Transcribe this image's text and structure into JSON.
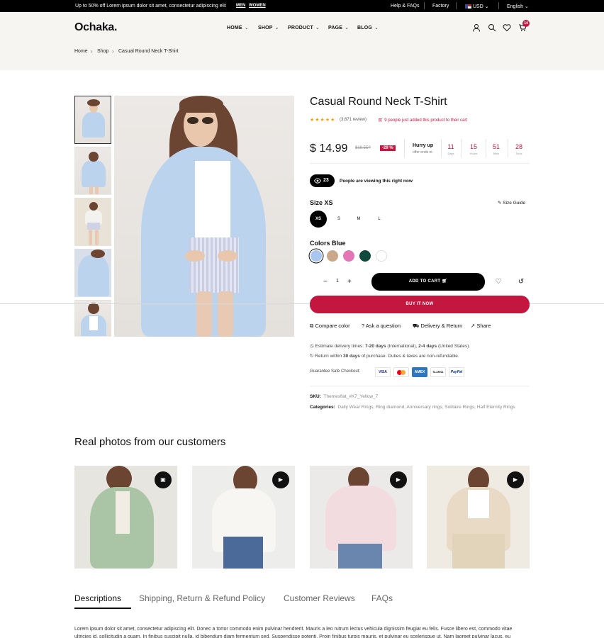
{
  "topbar": {
    "promo": "Up to 50% off Lorem ipsum dolor sit amet, consectetur adipiscing elit",
    "link_men": "MEN",
    "link_women": "WOMEN",
    "help": "Help & FAQs",
    "factory": "Factory",
    "currency": "USD",
    "language": "English"
  },
  "header": {
    "logo": "Ochaka.",
    "nav": [
      "HOME",
      "SHOP",
      "PRODUCT",
      "PAGE",
      "BLOG"
    ],
    "cart_count": "14"
  },
  "breadcrumb": [
    "Home",
    "Shop",
    "Casual Round Neck T-Shirt"
  ],
  "product": {
    "title": "Casual Round Neck T-Shirt",
    "stars": "★★★★★",
    "reviews": "(3,671 review)",
    "cart_note": "9 people just added this product to their cart",
    "price": "$ 14.99",
    "old_price": "$19.55?",
    "discount": "-29 %",
    "hurry": "Hurry up",
    "offer_ends": "offer ends in:",
    "countdown": [
      {
        "value": "11",
        "label": "Days"
      },
      {
        "value": "15",
        "label": "Hours"
      },
      {
        "value": "51",
        "label": "Mins"
      },
      {
        "value": "28",
        "label": "Secs"
      }
    ],
    "viewers_count": "23",
    "viewers_text": "People are viewing this right now",
    "size_label": "Size XS",
    "size_guide": "Size Guide",
    "sizes": [
      "XS",
      "S",
      "M",
      "L"
    ],
    "colors_label": "Colors Blue",
    "colors": [
      "#a9c6ee",
      "#c9a98a",
      "#e377b6",
      "#0f4a3c",
      "#ffffff"
    ],
    "quantity": "1",
    "add_to_cart": "ADD TO CART",
    "buy_now": "BUY IT NOW",
    "actions": [
      "Compare color",
      "Ask a question",
      "Delivery & Return",
      "Share"
    ],
    "delivery_prefix": "Estimate delivery times:",
    "delivery_intl": "7-20 days",
    "delivery_intl_suffix": "(International),",
    "delivery_us": "2-4 days",
    "delivery_us_suffix": "(United States).",
    "return_prefix": "Return within",
    "return_days": "30 days",
    "return_suffix": "of purchase. Duties & taxes are non-refundable.",
    "checkout_label": "Guarantee Safe Checkout:",
    "payments": [
      "VISA",
      "MC",
      "AMEX",
      "KLARNA",
      "PayPal"
    ],
    "sku_label": "SKU:",
    "sku": "Themesflat_#K7_Yellow_7",
    "categories_label": "Categories:",
    "categories": "Daily Wear Rings, Ring diamond, Anniversary rings, Solitaire Rings, Half Eternity Rings"
  },
  "customers": {
    "title": "Real photos from our customers"
  },
  "tabs": [
    "Descriptions",
    "Shipping, Return & Refund Policy",
    "Customer Reviews",
    "FAQs"
  ],
  "description": "Lorem ipsum dolor sit amet, consectetur adipiscing elit. Donec a tortor commodo enim pulvinar hendrerit. Mauris a leo rutrum lectus vehicula dignissim feugiat eu felis. Fusce libero est, commodo vitae ultricies id, sollicitudin a quam. In finibus suscipit nulla, id bibendum diam fermentum sed. Suspendisse potenti. Proin finibus turpis mauris, et pulvinar eu scelerisque ut. Nam laoreet pulvinar lacus, eu"
}
